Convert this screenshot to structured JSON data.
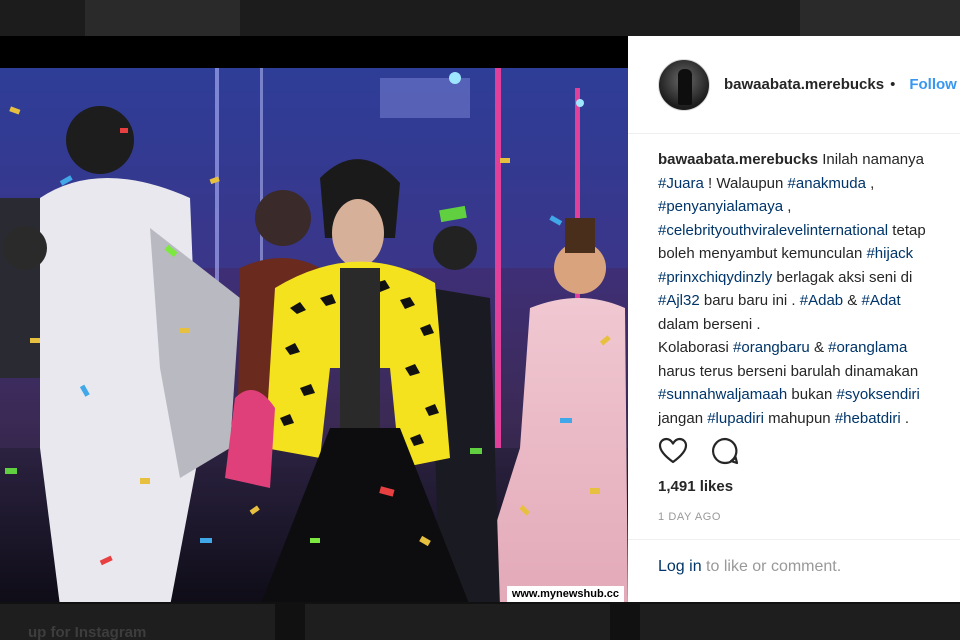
{
  "post": {
    "username": "bawaabata.merebucks",
    "separator": "•",
    "follow_label": "Follow",
    "watermark": "www.mynewshub.cc",
    "caption": [
      [
        {
          "t": "bawaabata.merebucks",
          "k": "user"
        },
        {
          "t": " Inilah namanya",
          "k": "text"
        }
      ],
      [
        {
          "t": "#Juara",
          "k": "tag"
        },
        {
          "t": " ! Walaupun ",
          "k": "text"
        },
        {
          "t": "#anakmuda",
          "k": "tag"
        },
        {
          "t": " ,",
          "k": "text"
        }
      ],
      [
        {
          "t": "#penyanyialamaya",
          "k": "tag"
        },
        {
          "t": " ,",
          "k": "text"
        }
      ],
      [
        {
          "t": "#celebrityouthviralevelinternational",
          "k": "tag"
        },
        {
          "t": " tetap",
          "k": "text"
        }
      ],
      [
        {
          "t": "boleh menyambut kemunculan ",
          "k": "text"
        },
        {
          "t": "#hijack",
          "k": "tag"
        }
      ],
      [
        {
          "t": "#prinxchiqydinzly",
          "k": "tag"
        },
        {
          "t": " berlagak aksi seni di",
          "k": "text"
        }
      ],
      [
        {
          "t": "#Ajl32",
          "k": "tag"
        },
        {
          "t": " baru baru ini . ",
          "k": "text"
        },
        {
          "t": "#Adab",
          "k": "tag"
        },
        {
          "t": " & ",
          "k": "text"
        },
        {
          "t": "#Adat",
          "k": "tag"
        }
      ],
      [
        {
          "t": "dalam berseni .",
          "k": "text"
        }
      ],
      [
        {
          "t": "Kolaborasi ",
          "k": "text"
        },
        {
          "t": "#orangbaru",
          "k": "tag"
        },
        {
          "t": " & ",
          "k": "text"
        },
        {
          "t": "#oranglama",
          "k": "tag"
        }
      ],
      [
        {
          "t": "harus terus berseni barulah dinamakan",
          "k": "text"
        }
      ],
      [
        {
          "t": "#sunnahwaljamaah",
          "k": "tag"
        },
        {
          "t": " bukan ",
          "k": "text"
        },
        {
          "t": "#syoksendiri",
          "k": "tag"
        }
      ],
      [
        {
          "t": "jangan ",
          "k": "text"
        },
        {
          "t": "#lupadiri",
          "k": "tag"
        },
        {
          "t": " mahupun ",
          "k": "text"
        },
        {
          "t": "#hebatdiri",
          "k": "tag"
        },
        {
          "t": " .",
          "k": "text"
        }
      ]
    ],
    "likes": "1,491 likes",
    "timestamp": "1 DAY AGO",
    "login_link": "Log in",
    "login_rest": " to like or comment.",
    "icons": {
      "like": "heart-icon",
      "comment": "comment-icon"
    }
  },
  "background": {
    "caption": "up for Instagram"
  },
  "colors": {
    "link": "#003569",
    "follow": "#3897f0",
    "muted": "#999999",
    "text": "#262626"
  }
}
